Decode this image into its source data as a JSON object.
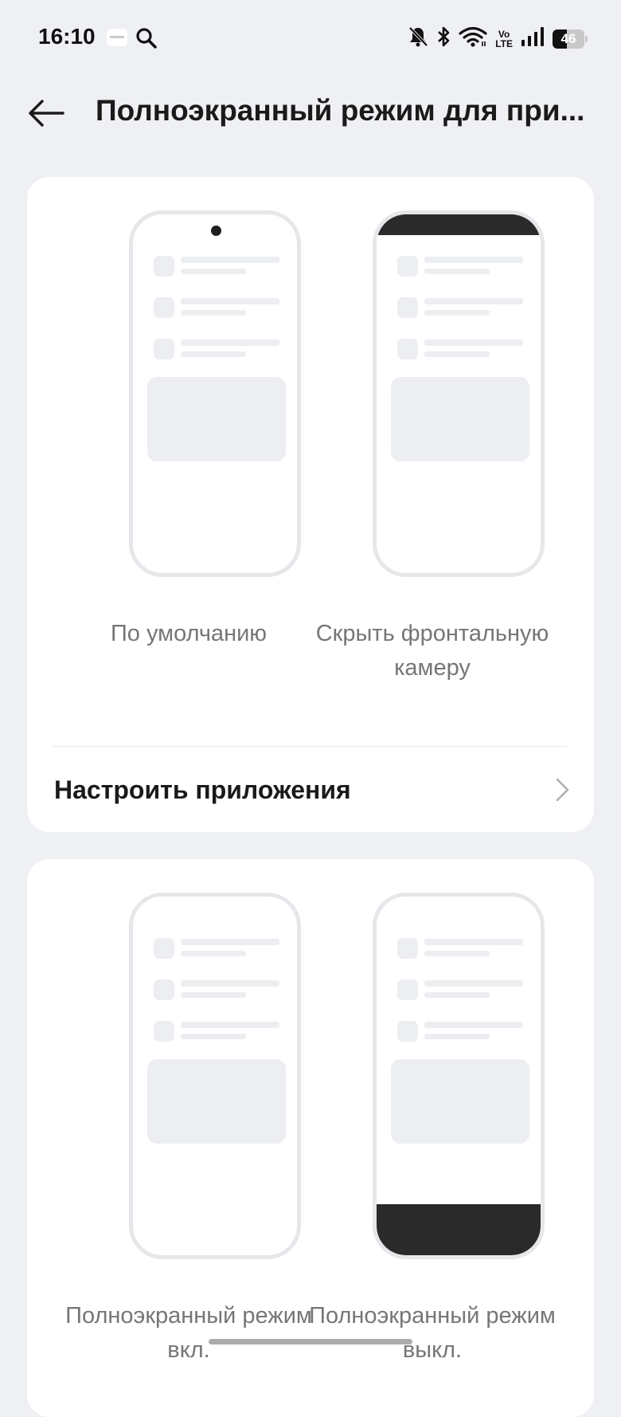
{
  "status_bar": {
    "time": "16:10",
    "volte_top": "Vo",
    "volte_bottom": "LTE",
    "battery_level": "46",
    "battery_fraction": 0.46,
    "icons": [
      "app-notification-icon",
      "search-icon",
      "bell-off-icon",
      "bluetooth-icon",
      "wifi-icon",
      "volte-icon",
      "signal-icon",
      "battery-icon"
    ]
  },
  "header": {
    "title": "Полноэкранный режим для при..."
  },
  "camera_section": {
    "options": [
      {
        "label": "По умолчанию",
        "preview": "camera-visible"
      },
      {
        "label": "Скрыть фронтальную камеру",
        "preview": "camera-hidden"
      }
    ],
    "configure_label": "Настроить приложения"
  },
  "fullscreen_section": {
    "options": [
      {
        "label": "Полноэкранный режим вкл.",
        "preview": "fullscreen-on"
      },
      {
        "label": "Полноэкранный режим выкл.",
        "preview": "fullscreen-off"
      }
    ]
  },
  "colors": {
    "background": "#eff0f3",
    "card": "#ffffff",
    "phone_frame": "#e6e7ea",
    "bar_dark": "#2a2a2a",
    "caption": "#767676"
  }
}
